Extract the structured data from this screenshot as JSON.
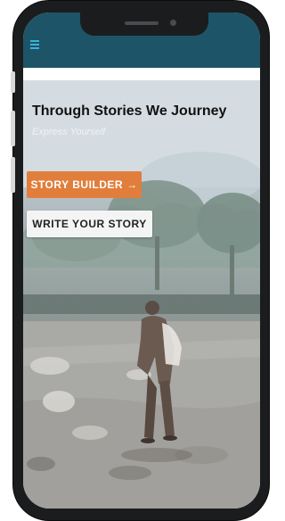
{
  "app": {
    "menu_icon": "hamburger-menu-icon",
    "topbar_color": "#1d5467",
    "accent_color": "#e17e3c"
  },
  "hero": {
    "title": "Through Stories We Journey",
    "subtitle": "Express Yourself",
    "background_image": "watercolor-person-walking-in-field"
  },
  "buttons": {
    "story_builder_label": "STORY BUILDER",
    "story_builder_arrow": "→",
    "write_story_label": "WRITE YOUR STORY"
  }
}
